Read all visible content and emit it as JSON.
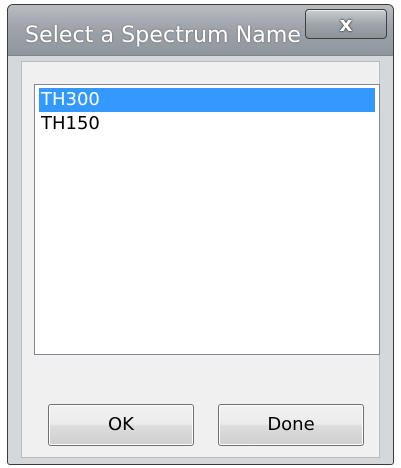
{
  "window": {
    "title": "Select a Spectrum Name",
    "close_label": "x"
  },
  "list": {
    "items": [
      {
        "label": "TH300",
        "selected": true
      },
      {
        "label": "TH150",
        "selected": false
      }
    ]
  },
  "buttons": {
    "ok_label": "OK",
    "done_label": "Done"
  },
  "colors": {
    "selection": "#3399ff",
    "titlebar": "#9ea4aa"
  }
}
